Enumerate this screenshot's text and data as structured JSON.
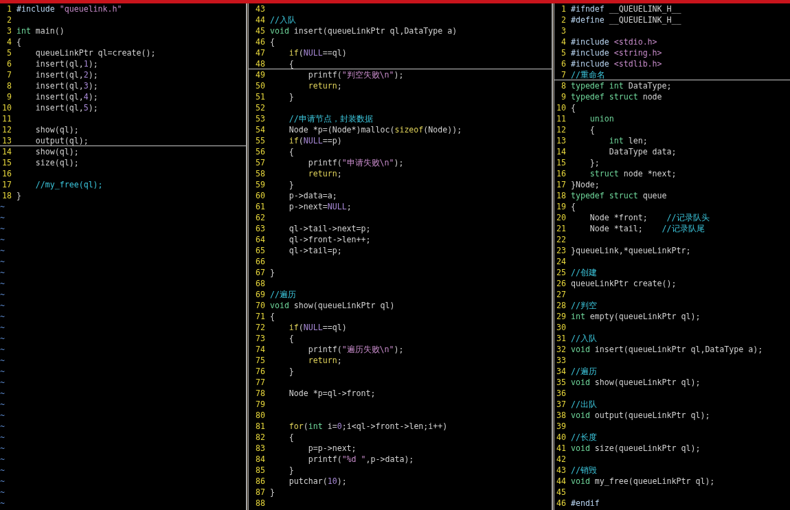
{
  "panes": [
    {
      "lines": [
        {
          "number": "1",
          "cursor": false,
          "tokens": [
            {
              "kind": "preproc",
              "text": "#include"
            },
            {
              "kind": "string",
              "text": " \"queuelink.h\""
            }
          ]
        },
        {
          "number": "2",
          "cursor": false
        },
        {
          "number": "3",
          "cursor": false,
          "tokens": [
            {
              "kind": "type",
              "text": "int"
            },
            {
              "kind": "plain",
              "text": " main()"
            }
          ]
        },
        {
          "number": "4",
          "cursor": false,
          "tokens": [
            {
              "kind": "plain",
              "text": "{"
            }
          ]
        },
        {
          "number": "5",
          "cursor": false,
          "tokens": [
            {
              "kind": "plain",
              "text": "    queueLinkPtr ql=create();"
            }
          ]
        },
        {
          "number": "6",
          "cursor": false,
          "tokens": [
            {
              "kind": "plain",
              "text": "    insert(ql,"
            },
            {
              "kind": "constant",
              "text": "1"
            },
            {
              "kind": "plain",
              "text": ");"
            }
          ]
        },
        {
          "number": "7",
          "cursor": false,
          "tokens": [
            {
              "kind": "plain",
              "text": "    insert(ql,"
            },
            {
              "kind": "constant",
              "text": "2"
            },
            {
              "kind": "plain",
              "text": ");"
            }
          ]
        },
        {
          "number": "8",
          "cursor": false,
          "tokens": [
            {
              "kind": "plain",
              "text": "    insert(ql,"
            },
            {
              "kind": "constant",
              "text": "3"
            },
            {
              "kind": "plain",
              "text": ");"
            }
          ]
        },
        {
          "number": "9",
          "cursor": false,
          "tokens": [
            {
              "kind": "plain",
              "text": "    insert(ql,"
            },
            {
              "kind": "constant",
              "text": "4"
            },
            {
              "kind": "plain",
              "text": ");"
            }
          ]
        },
        {
          "number": "10",
          "cursor": false,
          "tokens": [
            {
              "kind": "plain",
              "text": "    insert(ql,"
            },
            {
              "kind": "constant",
              "text": "5"
            },
            {
              "kind": "plain",
              "text": ");"
            }
          ]
        },
        {
          "number": "11",
          "cursor": false
        },
        {
          "number": "12",
          "cursor": false,
          "tokens": [
            {
              "kind": "plain",
              "text": "    show(ql);"
            }
          ]
        },
        {
          "number": "13",
          "cursor": true,
          "tokens": [
            {
              "kind": "plain",
              "text": "    output(ql);"
            }
          ]
        },
        {
          "number": "14",
          "cursor": false,
          "tokens": [
            {
              "kind": "plain",
              "text": "    show(ql);"
            }
          ]
        },
        {
          "number": "15",
          "cursor": false,
          "tokens": [
            {
              "kind": "plain",
              "text": "    size(ql);"
            }
          ]
        },
        {
          "number": "16",
          "cursor": false
        },
        {
          "number": "17",
          "cursor": false,
          "tokens": [
            {
              "kind": "comment",
              "text": "    //my_free(ql);"
            }
          ]
        },
        {
          "number": "18",
          "cursor": false,
          "tokens": [
            {
              "kind": "plain",
              "text": "}"
            }
          ]
        }
      ],
      "filler": [
        "~",
        "~",
        "~",
        "~",
        "~",
        "~",
        "~",
        "~",
        "~",
        "~",
        "~",
        "~",
        "~",
        "~",
        "~",
        "~",
        "~",
        "~",
        "~",
        "~",
        "~",
        "~",
        "~",
        "~",
        "~",
        "~",
        "~",
        "~"
      ]
    },
    {
      "lines": [
        {
          "number": "43",
          "cursor": false
        },
        {
          "number": "44",
          "cursor": false,
          "tokens": [
            {
              "kind": "comment",
              "text": "//入队"
            }
          ]
        },
        {
          "number": "45",
          "cursor": false,
          "tokens": [
            {
              "kind": "type",
              "text": "void"
            },
            {
              "kind": "plain",
              "text": " insert(queueLinkPtr ql,DataType a)"
            }
          ]
        },
        {
          "number": "46",
          "cursor": false,
          "tokens": [
            {
              "kind": "plain",
              "text": "{"
            }
          ]
        },
        {
          "number": "47",
          "cursor": false,
          "tokens": [
            {
              "kind": "keyword",
              "text": "    if"
            },
            {
              "kind": "plain",
              "text": "("
            },
            {
              "kind": "constant",
              "text": "NULL"
            },
            {
              "kind": "plain",
              "text": "==ql)"
            }
          ]
        },
        {
          "number": "48",
          "cursor": true,
          "tokens": [
            {
              "kind": "plain",
              "text": "    {"
            }
          ]
        },
        {
          "number": "49",
          "cursor": false,
          "tokens": [
            {
              "kind": "plain",
              "text": "        printf("
            },
            {
              "kind": "string",
              "text": "\"判空失败\\n\""
            },
            {
              "kind": "plain",
              "text": ");"
            }
          ]
        },
        {
          "number": "50",
          "cursor": false,
          "tokens": [
            {
              "kind": "keyword",
              "text": "        return"
            },
            {
              "kind": "plain",
              "text": ";"
            }
          ]
        },
        {
          "number": "51",
          "cursor": false,
          "tokens": [
            {
              "kind": "plain",
              "text": "    }"
            }
          ]
        },
        {
          "number": "52",
          "cursor": false
        },
        {
          "number": "53",
          "cursor": false,
          "tokens": [
            {
              "kind": "comment",
              "text": "    //申请节点，封装数据"
            }
          ]
        },
        {
          "number": "54",
          "cursor": false,
          "tokens": [
            {
              "kind": "plain",
              "text": "    Node *p=(Node*)malloc("
            },
            {
              "kind": "keyword",
              "text": "sizeof"
            },
            {
              "kind": "plain",
              "text": "(Node));"
            }
          ]
        },
        {
          "number": "55",
          "cursor": false,
          "tokens": [
            {
              "kind": "keyword",
              "text": "    if"
            },
            {
              "kind": "plain",
              "text": "("
            },
            {
              "kind": "constant",
              "text": "NULL"
            },
            {
              "kind": "plain",
              "text": "==p)"
            }
          ]
        },
        {
          "number": "56",
          "cursor": false,
          "tokens": [
            {
              "kind": "plain",
              "text": "    {"
            }
          ]
        },
        {
          "number": "57",
          "cursor": false,
          "tokens": [
            {
              "kind": "plain",
              "text": "        printf("
            },
            {
              "kind": "string",
              "text": "\"申请失败\\n\""
            },
            {
              "kind": "plain",
              "text": ");"
            }
          ]
        },
        {
          "number": "58",
          "cursor": false,
          "tokens": [
            {
              "kind": "keyword",
              "text": "        return"
            },
            {
              "kind": "plain",
              "text": ";"
            }
          ]
        },
        {
          "number": "59",
          "cursor": false,
          "tokens": [
            {
              "kind": "plain",
              "text": "    }"
            }
          ]
        },
        {
          "number": "60",
          "cursor": false,
          "tokens": [
            {
              "kind": "plain",
              "text": "    p->data=a;"
            }
          ]
        },
        {
          "number": "61",
          "cursor": false,
          "tokens": [
            {
              "kind": "plain",
              "text": "    p->next="
            },
            {
              "kind": "constant",
              "text": "NULL"
            },
            {
              "kind": "plain",
              "text": ";"
            }
          ]
        },
        {
          "number": "62",
          "cursor": false
        },
        {
          "number": "63",
          "cursor": false,
          "tokens": [
            {
              "kind": "plain",
              "text": "    ql->tail->next=p;"
            }
          ]
        },
        {
          "number": "64",
          "cursor": false,
          "tokens": [
            {
              "kind": "plain",
              "text": "    ql->front->len++;"
            }
          ]
        },
        {
          "number": "65",
          "cursor": false,
          "tokens": [
            {
              "kind": "plain",
              "text": "    ql->tail=p;"
            }
          ]
        },
        {
          "number": "66",
          "cursor": false
        },
        {
          "number": "67",
          "cursor": false,
          "tokens": [
            {
              "kind": "plain",
              "text": "}"
            }
          ]
        },
        {
          "number": "68",
          "cursor": false
        },
        {
          "number": "69",
          "cursor": false,
          "tokens": [
            {
              "kind": "comment",
              "text": "//遍历"
            }
          ]
        },
        {
          "number": "70",
          "cursor": false,
          "tokens": [
            {
              "kind": "type",
              "text": "void"
            },
            {
              "kind": "plain",
              "text": " show(queueLinkPtr ql)"
            }
          ]
        },
        {
          "number": "71",
          "cursor": false,
          "tokens": [
            {
              "kind": "plain",
              "text": "{"
            }
          ]
        },
        {
          "number": "72",
          "cursor": false,
          "tokens": [
            {
              "kind": "keyword",
              "text": "    if"
            },
            {
              "kind": "plain",
              "text": "("
            },
            {
              "kind": "constant",
              "text": "NULL"
            },
            {
              "kind": "plain",
              "text": "==ql)"
            }
          ]
        },
        {
          "number": "73",
          "cursor": false,
          "tokens": [
            {
              "kind": "plain",
              "text": "    {"
            }
          ]
        },
        {
          "number": "74",
          "cursor": false,
          "tokens": [
            {
              "kind": "plain",
              "text": "        printf("
            },
            {
              "kind": "string",
              "text": "\"遍历失败\\n\""
            },
            {
              "kind": "plain",
              "text": ");"
            }
          ]
        },
        {
          "number": "75",
          "cursor": false,
          "tokens": [
            {
              "kind": "keyword",
              "text": "        return"
            },
            {
              "kind": "plain",
              "text": ";"
            }
          ]
        },
        {
          "number": "76",
          "cursor": false,
          "tokens": [
            {
              "kind": "plain",
              "text": "    }"
            }
          ]
        },
        {
          "number": "77",
          "cursor": false
        },
        {
          "number": "78",
          "cursor": false,
          "tokens": [
            {
              "kind": "plain",
              "text": "    Node *p=ql->front;"
            }
          ]
        },
        {
          "number": "79",
          "cursor": false
        },
        {
          "number": "80",
          "cursor": false
        },
        {
          "number": "81",
          "cursor": false,
          "tokens": [
            {
              "kind": "keyword",
              "text": "    for"
            },
            {
              "kind": "plain",
              "text": "("
            },
            {
              "kind": "type",
              "text": "int"
            },
            {
              "kind": "plain",
              "text": " i="
            },
            {
              "kind": "constant",
              "text": "0"
            },
            {
              "kind": "plain",
              "text": ";i<ql->front->len;i++)"
            }
          ]
        },
        {
          "number": "82",
          "cursor": false,
          "tokens": [
            {
              "kind": "plain",
              "text": "    {"
            }
          ]
        },
        {
          "number": "83",
          "cursor": false,
          "tokens": [
            {
              "kind": "plain",
              "text": "        p=p->next;"
            }
          ]
        },
        {
          "number": "84",
          "cursor": false,
          "tokens": [
            {
              "kind": "plain",
              "text": "        printf("
            },
            {
              "kind": "string",
              "text": "\"%d \""
            },
            {
              "kind": "plain",
              "text": ",p->data);"
            }
          ]
        },
        {
          "number": "85",
          "cursor": false,
          "tokens": [
            {
              "kind": "plain",
              "text": "    }"
            }
          ]
        },
        {
          "number": "86",
          "cursor": false,
          "tokens": [
            {
              "kind": "plain",
              "text": "    putchar("
            },
            {
              "kind": "constant",
              "text": "10"
            },
            {
              "kind": "plain",
              "text": ");"
            }
          ]
        },
        {
          "number": "87",
          "cursor": false,
          "tokens": [
            {
              "kind": "plain",
              "text": "}"
            }
          ]
        },
        {
          "number": "88",
          "cursor": false
        }
      ]
    },
    {
      "lines": [
        {
          "number": "1",
          "cursor": false,
          "tokens": [
            {
              "kind": "preproc",
              "text": "#ifndef"
            },
            {
              "kind": "plain",
              "text": " __QUEUELINK_H__"
            }
          ]
        },
        {
          "number": "2",
          "cursor": false,
          "tokens": [
            {
              "kind": "preproc",
              "text": "#define"
            },
            {
              "kind": "plain",
              "text": " __QUEUELINK_H__"
            }
          ]
        },
        {
          "number": "3",
          "cursor": false
        },
        {
          "number": "4",
          "cursor": false,
          "tokens": [
            {
              "kind": "preproc",
              "text": "#include"
            },
            {
              "kind": "string",
              "text": " <stdio.h>"
            }
          ]
        },
        {
          "number": "5",
          "cursor": false,
          "tokens": [
            {
              "kind": "preproc",
              "text": "#include"
            },
            {
              "kind": "string",
              "text": " <string.h>"
            }
          ]
        },
        {
          "number": "6",
          "cursor": false,
          "tokens": [
            {
              "kind": "preproc",
              "text": "#include"
            },
            {
              "kind": "string",
              "text": " <stdlib.h>"
            }
          ]
        },
        {
          "number": "7",
          "cursor": true,
          "tokens": [
            {
              "kind": "comment",
              "text": "//重命名"
            }
          ]
        },
        {
          "number": "8",
          "cursor": false,
          "tokens": [
            {
              "kind": "type",
              "text": "typedef int"
            },
            {
              "kind": "plain",
              "text": " DataType;"
            }
          ]
        },
        {
          "number": "9",
          "cursor": false,
          "tokens": [
            {
              "kind": "type",
              "text": "typedef struct"
            },
            {
              "kind": "plain",
              "text": " node"
            }
          ]
        },
        {
          "number": "10",
          "cursor": false,
          "tokens": [
            {
              "kind": "plain",
              "text": "{"
            }
          ]
        },
        {
          "number": "11",
          "cursor": false,
          "tokens": [
            {
              "kind": "type",
              "text": "    union"
            }
          ]
        },
        {
          "number": "12",
          "cursor": false,
          "tokens": [
            {
              "kind": "plain",
              "text": "    {"
            }
          ]
        },
        {
          "number": "13",
          "cursor": false,
          "tokens": [
            {
              "kind": "type",
              "text": "        int"
            },
            {
              "kind": "plain",
              "text": " len;"
            }
          ]
        },
        {
          "number": "14",
          "cursor": false,
          "tokens": [
            {
              "kind": "plain",
              "text": "        DataType data;"
            }
          ]
        },
        {
          "number": "15",
          "cursor": false,
          "tokens": [
            {
              "kind": "plain",
              "text": "    };"
            }
          ]
        },
        {
          "number": "16",
          "cursor": false,
          "tokens": [
            {
              "kind": "type",
              "text": "    struct"
            },
            {
              "kind": "plain",
              "text": " node *next;"
            }
          ]
        },
        {
          "number": "17",
          "cursor": false,
          "tokens": [
            {
              "kind": "plain",
              "text": "}Node;"
            }
          ]
        },
        {
          "number": "18",
          "cursor": false,
          "tokens": [
            {
              "kind": "type",
              "text": "typedef struct"
            },
            {
              "kind": "plain",
              "text": " queue"
            }
          ]
        },
        {
          "number": "19",
          "cursor": false,
          "tokens": [
            {
              "kind": "plain",
              "text": "{"
            }
          ]
        },
        {
          "number": "20",
          "cursor": false,
          "tokens": [
            {
              "kind": "plain",
              "text": "    Node *front;"
            },
            {
              "kind": "comment",
              "text": "    //记录队头"
            }
          ]
        },
        {
          "number": "21",
          "cursor": false,
          "tokens": [
            {
              "kind": "plain",
              "text": "    Node *tail;"
            },
            {
              "kind": "comment",
              "text": "    //记录队尾"
            }
          ]
        },
        {
          "number": "22",
          "cursor": false
        },
        {
          "number": "23",
          "cursor": false,
          "tokens": [
            {
              "kind": "plain",
              "text": "}queueLink,*queueLinkPtr;"
            }
          ]
        },
        {
          "number": "24",
          "cursor": false
        },
        {
          "number": "25",
          "cursor": false,
          "tokens": [
            {
              "kind": "comment",
              "text": "//创建"
            }
          ]
        },
        {
          "number": "26",
          "cursor": false,
          "tokens": [
            {
              "kind": "plain",
              "text": "queueLinkPtr create();"
            }
          ]
        },
        {
          "number": "27",
          "cursor": false
        },
        {
          "number": "28",
          "cursor": false,
          "tokens": [
            {
              "kind": "comment",
              "text": "//判空"
            }
          ]
        },
        {
          "number": "29",
          "cursor": false,
          "tokens": [
            {
              "kind": "type",
              "text": "int"
            },
            {
              "kind": "plain",
              "text": " empty(queueLinkPtr ql);"
            }
          ]
        },
        {
          "number": "30",
          "cursor": false
        },
        {
          "number": "31",
          "cursor": false,
          "tokens": [
            {
              "kind": "comment",
              "text": "//入队"
            }
          ]
        },
        {
          "number": "32",
          "cursor": false,
          "tokens": [
            {
              "kind": "type",
              "text": "void"
            },
            {
              "kind": "plain",
              "text": " insert(queueLinkPtr ql,DataType a);"
            }
          ]
        },
        {
          "number": "33",
          "cursor": false
        },
        {
          "number": "34",
          "cursor": false,
          "tokens": [
            {
              "kind": "comment",
              "text": "//遍历"
            }
          ]
        },
        {
          "number": "35",
          "cursor": false,
          "tokens": [
            {
              "kind": "type",
              "text": "void"
            },
            {
              "kind": "plain",
              "text": " show(queueLinkPtr ql);"
            }
          ]
        },
        {
          "number": "36",
          "cursor": false
        },
        {
          "number": "37",
          "cursor": false,
          "tokens": [
            {
              "kind": "comment",
              "text": "//出队"
            }
          ]
        },
        {
          "number": "38",
          "cursor": false,
          "tokens": [
            {
              "kind": "type",
              "text": "void"
            },
            {
              "kind": "plain",
              "text": " output(queueLinkPtr ql);"
            }
          ]
        },
        {
          "number": "39",
          "cursor": false
        },
        {
          "number": "40",
          "cursor": false,
          "tokens": [
            {
              "kind": "comment",
              "text": "//长度"
            }
          ]
        },
        {
          "number": "41",
          "cursor": false,
          "tokens": [
            {
              "kind": "type",
              "text": "void"
            },
            {
              "kind": "plain",
              "text": " size(queueLinkPtr ql);"
            }
          ]
        },
        {
          "number": "42",
          "cursor": false
        },
        {
          "number": "43",
          "cursor": false,
          "tokens": [
            {
              "kind": "comment",
              "text": "//销毁"
            }
          ]
        },
        {
          "number": "44",
          "cursor": false,
          "tokens": [
            {
              "kind": "type",
              "text": "void"
            },
            {
              "kind": "plain",
              "text": " my_free(queueLinkPtr ql);"
            }
          ]
        },
        {
          "number": "45",
          "cursor": false
        },
        {
          "number": "46",
          "cursor": false,
          "tokens": [
            {
              "kind": "preproc",
              "text": "#endif"
            }
          ]
        }
      ]
    }
  ]
}
